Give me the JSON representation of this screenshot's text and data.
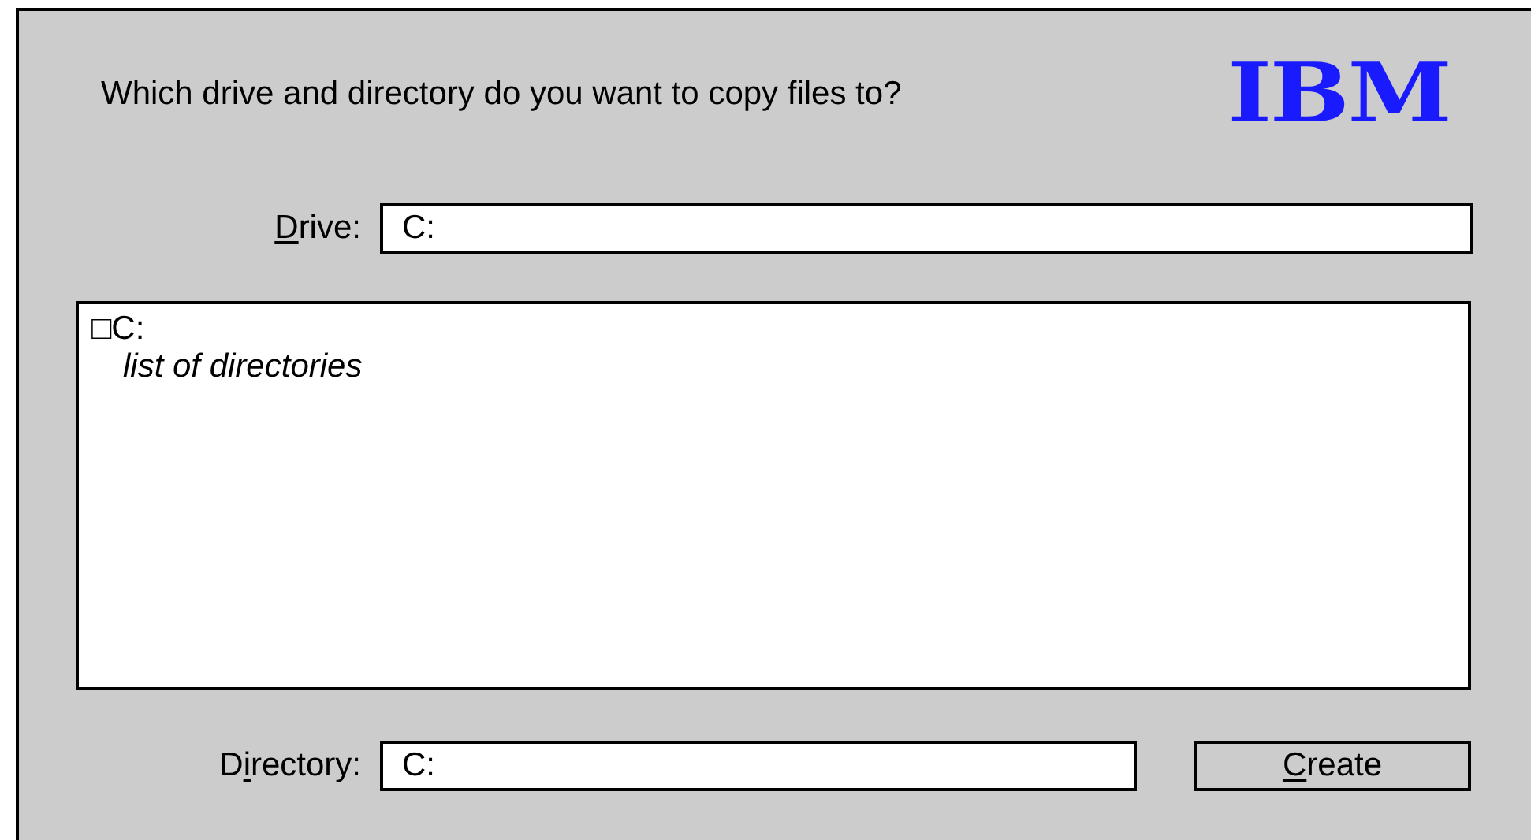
{
  "prompt": "Which drive and directory do you want to copy files to?",
  "logo": "IBM",
  "drive": {
    "label": {
      "mnemonic": "D",
      "after": "rive:"
    },
    "value": "C:"
  },
  "tree": {
    "root": {
      "marker": "□",
      "label": "C:",
      "children": [
        {
          "label": "list of directories"
        }
      ]
    }
  },
  "directory": {
    "label": {
      "before": "D",
      "mnemonic": "i",
      "after": "rectory:"
    },
    "value": "C:"
  },
  "buttons": [
    {
      "label": {
        "mnemonic": "C",
        "after": "reate"
      }
    }
  ]
}
